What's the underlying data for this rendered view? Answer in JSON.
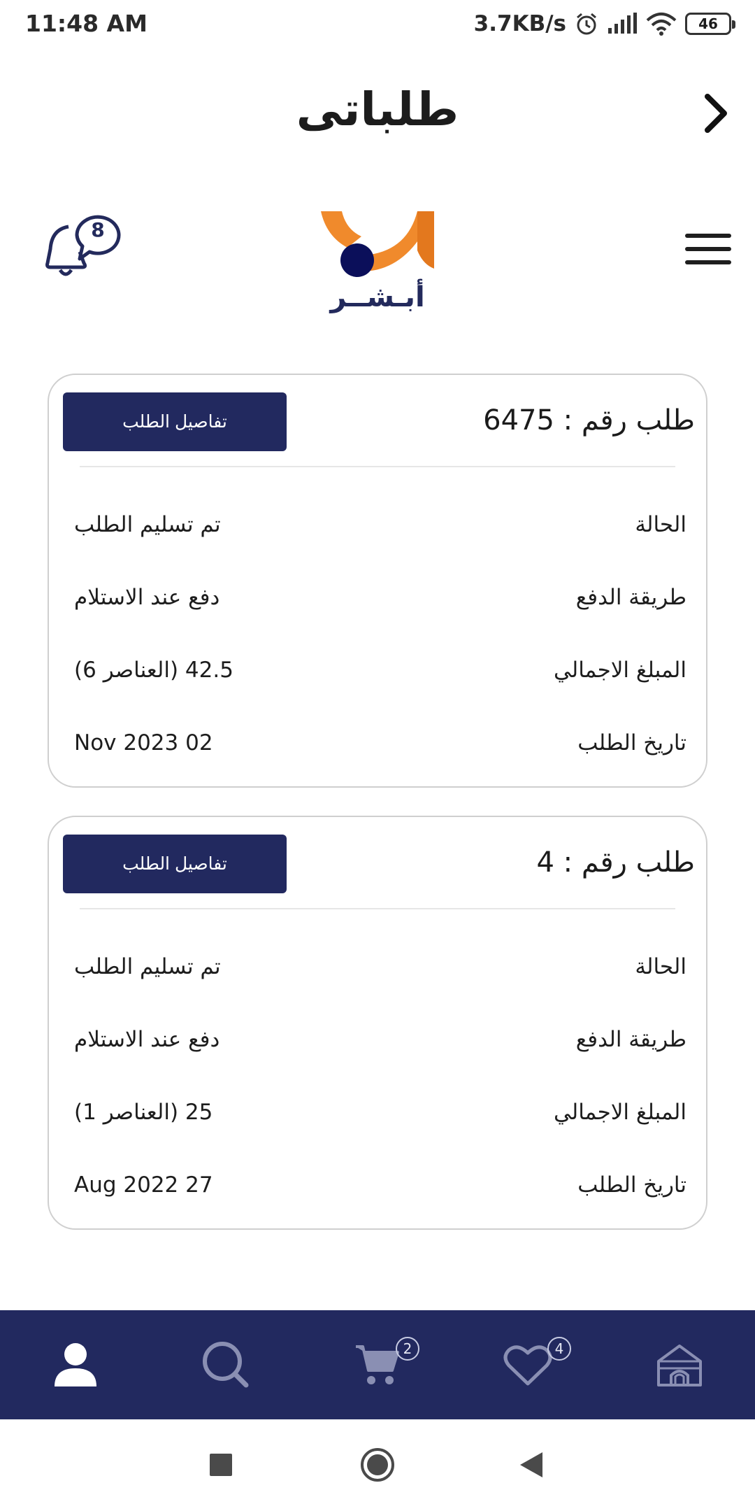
{
  "status_bar": {
    "time": "11:48 AM",
    "speed": "3.7KB/s",
    "battery": "46"
  },
  "header": {
    "title": "طلباتى"
  },
  "app_bar": {
    "logo_text": "أبـشــر",
    "notification_count": "8",
    "colors": {
      "brand_navy": "#22295f",
      "logo_orange": "#f08a2c"
    }
  },
  "orders": [
    {
      "title": "طلب رقم : 6475",
      "details_label": "تفاصيل الطلب",
      "status_label": "الحالة",
      "status_value": "تم تسليم الطلب",
      "payment_label": "طريقة الدفع",
      "payment_value": "دفع عند الاستلام",
      "total_label": "المبلغ الاجمالي",
      "total_value": "42.5 (العناصر 6)",
      "date_label": "تاريخ الطلب",
      "date_value": "Nov 2023 02"
    },
    {
      "title": "طلب رقم : 4",
      "details_label": "تفاصيل الطلب",
      "status_label": "الحالة",
      "status_value": "تم تسليم الطلب",
      "payment_label": "طريقة الدفع",
      "payment_value": "دفع عند الاستلام",
      "total_label": "المبلغ الاجمالي",
      "total_value": "25 (العناصر 1)",
      "date_label": "تاريخ الطلب",
      "date_value": "Aug 2022 27"
    }
  ],
  "bottom_nav": {
    "items": [
      {
        "icon": "user-icon"
      },
      {
        "icon": "search-icon"
      },
      {
        "icon": "cart-icon",
        "badge": "2"
      },
      {
        "icon": "heart-icon",
        "badge": "4"
      },
      {
        "icon": "home-icon"
      }
    ]
  }
}
